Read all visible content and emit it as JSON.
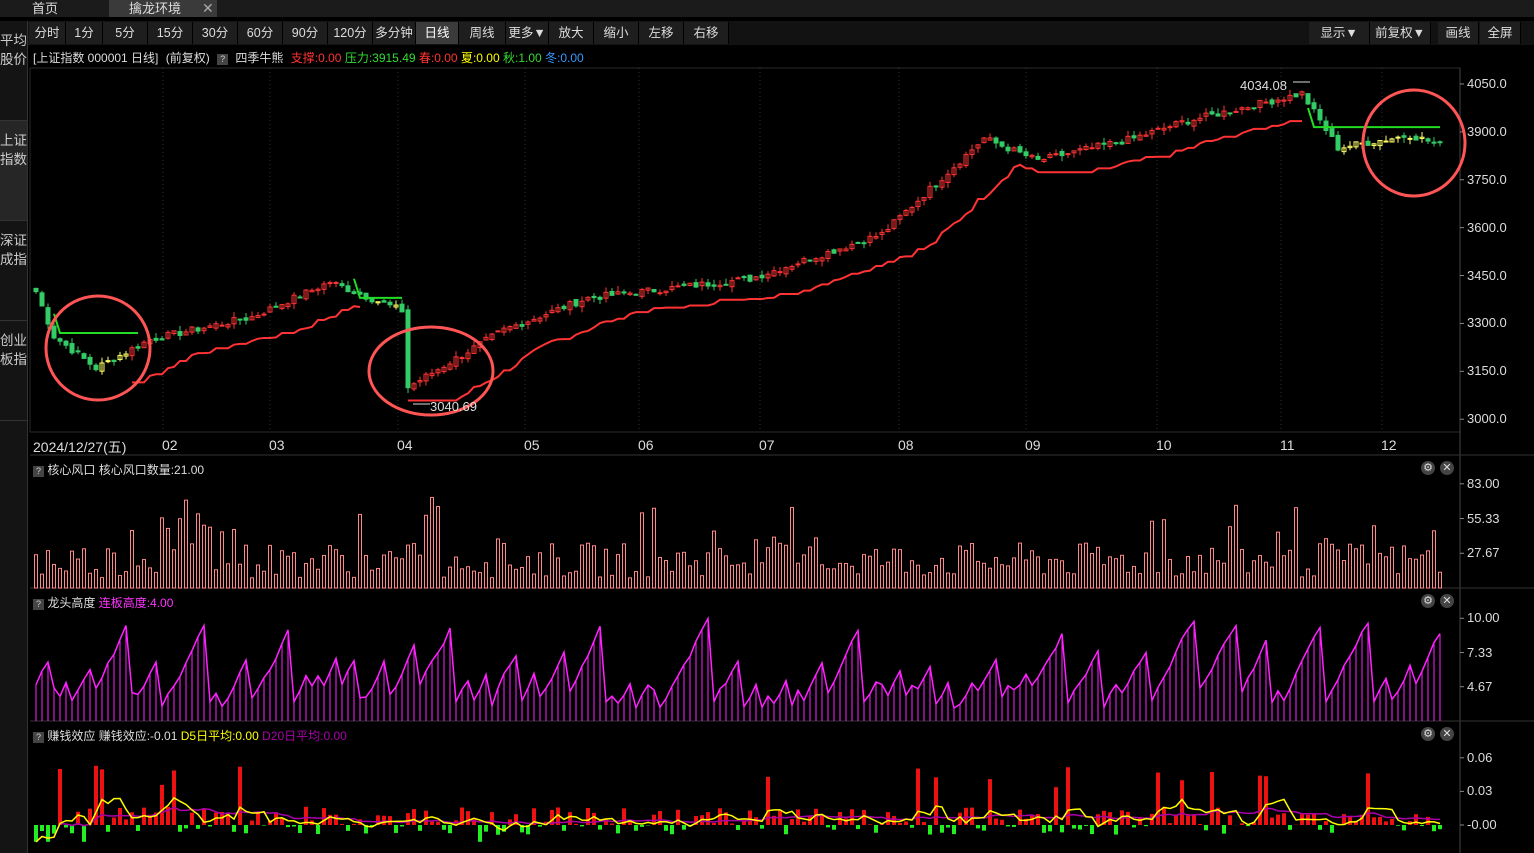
{
  "tabs": {
    "home": "首页",
    "active": "擒龙环境",
    "close": "✕"
  },
  "toolbar": {
    "buttons": [
      "分时",
      "1分",
      "5分",
      "15分",
      "30分",
      "60分",
      "90分",
      "120分",
      "多分钟",
      "日线",
      "周线",
      "更多▼",
      "放大",
      "缩小",
      "左移",
      "右移"
    ],
    "selected": "日线",
    "right_buttons": [
      "显示▼",
      "前复权▼",
      "画线",
      "全屏"
    ]
  },
  "sidebar": {
    "items": [
      "平均股价",
      "上证指数",
      "深证成指",
      "创业板指"
    ],
    "selected": "上证指数"
  },
  "main_info": {
    "name": "[上证指数 000001 日线]",
    "adjust": "(前复权)",
    "q": "?",
    "indicator": "四季牛熊",
    "support": "支撑:0.00",
    "pressure": "压力:3915.49",
    "spring": "春:0.00",
    "summer": "夏:0.00",
    "autumn": "秋:1.00",
    "winter": "冬:0.00",
    "colors": {
      "support": "#ff3333",
      "pressure": "#33dd33",
      "spring": "#ff3333",
      "summer": "#ffff00",
      "autumn": "#33dd33",
      "winter": "#3399ff"
    }
  },
  "x_axis": {
    "first_label": "2024/12/27(五)",
    "months": [
      "02",
      "03",
      "04",
      "05",
      "06",
      "07",
      "08",
      "09",
      "10",
      "11",
      "12"
    ]
  },
  "chart_data": [
    {
      "type": "candlestick",
      "title": "上证指数 000001 日线",
      "ylim": [
        2960,
        4100
      ],
      "yticks": [
        "4050.0",
        "3900.0",
        "3750.0",
        "3600.0",
        "3450.0",
        "3300.0",
        "3150.0",
        "3000.0"
      ],
      "ytick_values": [
        4050,
        3900,
        3750,
        3600,
        3450,
        3300,
        3150,
        3000
      ],
      "high_label": "4034.08",
      "low_label": "3040.69",
      "close_key_points": [
        {
          "date": "2024-12-27",
          "close": 3400
        },
        {
          "date": "2025-01-02",
          "close": 3260
        },
        {
          "date": "2025-01-13",
          "close": 3160
        },
        {
          "date": "2025-01-27",
          "close": 3250
        },
        {
          "date": "2025-02-28",
          "close": 3320
        },
        {
          "date": "2025-03-18",
          "close": 3430
        },
        {
          "date": "2025-04-03",
          "close": 3340
        },
        {
          "date": "2025-04-07",
          "close": 3100
        },
        {
          "date": "2025-04-30",
          "close": 3280
        },
        {
          "date": "2025-05-20",
          "close": 3380
        },
        {
          "date": "2025-06-30",
          "close": 3440
        },
        {
          "date": "2025-07-31",
          "close": 3580
        },
        {
          "date": "2025-08-25",
          "close": 3880
        },
        {
          "date": "2025-09-05",
          "close": 3810
        },
        {
          "date": "2025-09-30",
          "close": 3880
        },
        {
          "date": "2025-10-15",
          "close": 3930
        },
        {
          "date": "2025-11-13",
          "close": 4020
        },
        {
          "date": "2025-11-21",
          "close": 3850
        },
        {
          "date": "2025-12-10",
          "close": 3890
        },
        {
          "date": "2025-12-17",
          "close": 3860
        }
      ]
    },
    {
      "type": "bar",
      "title": "核心风口",
      "series_label": "核心风口数量:21.00",
      "ylim": [
        0,
        90
      ],
      "yticks": [
        "83.00",
        "55.33",
        "27.67"
      ],
      "ytick_values": [
        83,
        55.33,
        27.67
      ]
    },
    {
      "type": "line",
      "title": "龙头高度",
      "series_label": "连板高度:4.00",
      "ylim": [
        2,
        10.8
      ],
      "yticks": [
        "10.00",
        "7.33",
        "4.67"
      ],
      "ytick_values": [
        10,
        7.33,
        4.67
      ]
    },
    {
      "type": "bar",
      "title": "赚钱效应",
      "series_label": "赚钱效应:-0.01",
      "d5_label": "D5日平均:0.00",
      "d20_label": "D20日平均:0.00",
      "ylim": [
        -0.025,
        0.075
      ],
      "yticks": [
        "0.06",
        "0.03",
        "-0.00"
      ],
      "ytick_values": [
        0.06,
        0.03,
        0.0
      ]
    }
  ],
  "colors": {
    "up": "#ff3333",
    "down": "#33cc66",
    "yellow": "#ffff00",
    "pink": "#ff66ff",
    "magenta": "#ff22ff",
    "purple": "#aa00aa",
    "circle": "#ff5555"
  },
  "icons": [
    "gear-icon",
    "close-icon",
    "question-icon"
  ]
}
